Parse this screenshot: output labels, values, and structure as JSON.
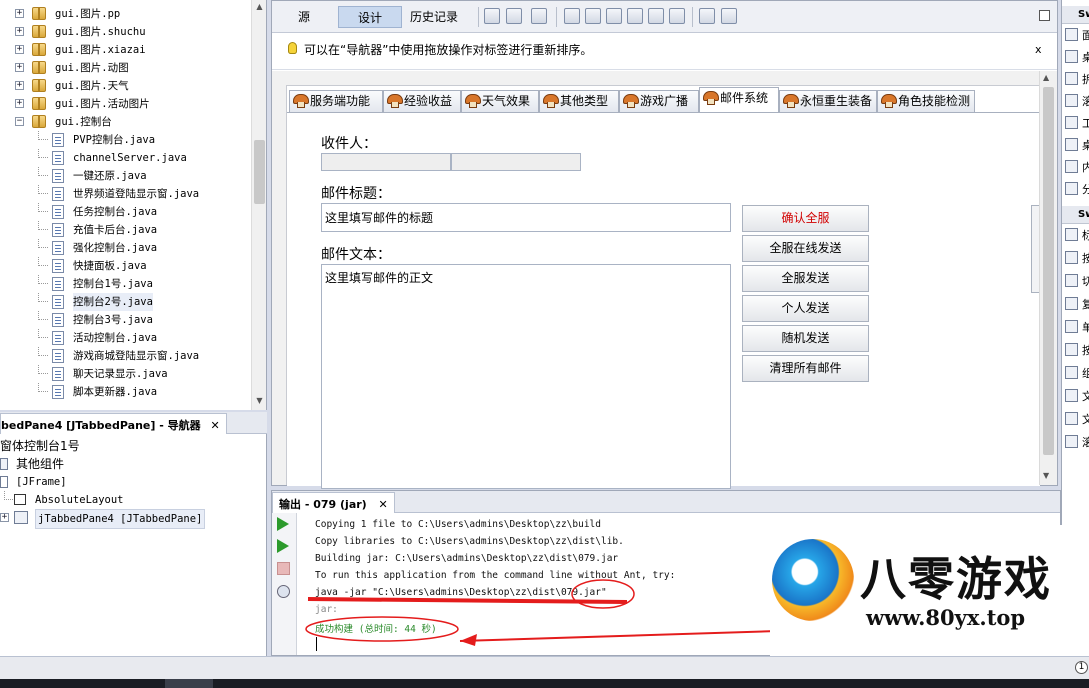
{
  "project_tree": {
    "items": [
      {
        "label": "gui.图片.pp",
        "type": "package",
        "expander": "+"
      },
      {
        "label": "gui.图片.shuchu",
        "type": "package",
        "expander": "+"
      },
      {
        "label": "gui.图片.xiazai",
        "type": "package",
        "expander": "+"
      },
      {
        "label": "gui.图片.动图",
        "type": "package",
        "expander": "+"
      },
      {
        "label": "gui.图片.天气",
        "type": "package",
        "expander": "+"
      },
      {
        "label": "gui.图片.活动图片",
        "type": "package",
        "expander": "+"
      },
      {
        "label": "gui.控制台",
        "type": "package",
        "expander": "−"
      },
      {
        "label": "PVP控制台.java",
        "type": "file"
      },
      {
        "label": "channelServer.java",
        "type": "file"
      },
      {
        "label": "一键还原.java",
        "type": "file"
      },
      {
        "label": "世界频道登陆显示窗.java",
        "type": "file"
      },
      {
        "label": "任务控制台.java",
        "type": "file"
      },
      {
        "label": "充值卡后台.java",
        "type": "file"
      },
      {
        "label": "强化控制台.java",
        "type": "file"
      },
      {
        "label": "快捷面板.java",
        "type": "file"
      },
      {
        "label": "控制台1号.java",
        "type": "file"
      },
      {
        "label": "控制台2号.java",
        "type": "file"
      },
      {
        "label": "控制台3号.java",
        "type": "file"
      },
      {
        "label": "活动控制台.java",
        "type": "file"
      },
      {
        "label": "游戏商城登陆显示窗.java",
        "type": "file"
      },
      {
        "label": "聊天记录显示.java",
        "type": "file"
      },
      {
        "label": "脚本更新器.java",
        "type": "file"
      }
    ]
  },
  "navigator": {
    "tab_label": "bedPane4 [JTabbedPane] - 导航器",
    "close": "✕",
    "items": [
      "窗体控制台1号",
      "其他组件",
      "[JFrame]",
      "AbsoluteLayout",
      "jTabbedPane4 [JTabbedPane]"
    ]
  },
  "editor": {
    "view_buttons": [
      "源",
      "设计",
      "历史记录"
    ],
    "hint_text": "可以在“导航器”中使用拖放操作对标签进行重新排序。",
    "hint_close": "x",
    "tabs": [
      "服务端功能",
      "经验收益",
      "天气效果",
      "其他类型",
      "游戏广播",
      "邮件系统",
      "永恒重生装备",
      "角色技能检测"
    ],
    "active_tab": "邮件系统",
    "form": {
      "recipient_label": "收件人：",
      "subject_label": "邮件标题：",
      "subject_value": "这里填写邮件的标题",
      "body_label": "邮件文本：",
      "body_value": "这里填写邮件的正文"
    },
    "buttons": [
      "确认全服",
      "全服在线发送",
      "全服发送",
      "个人发送",
      "随机发送",
      "清理所有邮件"
    ],
    "danger_color": "#d10000"
  },
  "palette": {
    "heading1": "Sw",
    "heading2": "Sw",
    "chars1": [
      "面",
      "桌",
      "拆",
      "滚",
      "工",
      "桌",
      "内",
      "分"
    ],
    "chars2": [
      "标",
      "按",
      "切",
      "复",
      "单",
      "按",
      "组",
      "文",
      "文",
      "滚"
    ],
    "label_badge": "label",
    "ok_badge": "OK",
    "on_badge": "ON",
    "tx_badge": "tx"
  },
  "output": {
    "tab_label": "输出 - 079 (jar)",
    "close": "✕",
    "lines": [
      "Copying 1 file to C:\\Users\\admins\\Desktop\\zz\\build",
      "Copy libraries to C:\\Users\\admins\\Desktop\\zz\\dist\\lib.",
      "Building jar: C:\\Users\\admins\\Desktop\\zz\\dist\\079.jar",
      "To run this application from the command line without Ant, try:",
      "java -jar \"C:\\Users\\admins\\Desktop\\zz\\dist\\079.jar\"",
      "jar:",
      "成功构建 (总时间: 44 秒)"
    ],
    "success_color": "#2a8a2a"
  },
  "watermark": {
    "brand": "八零游戏",
    "url": "www.80yx.top"
  },
  "status": {
    "counter": "1"
  }
}
